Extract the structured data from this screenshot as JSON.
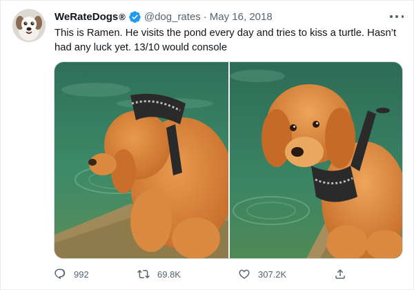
{
  "tweet": {
    "author": {
      "display_name": "WeRateDogs",
      "registered_mark": "®",
      "handle": "@dog_rates",
      "verified": true
    },
    "separator": "·",
    "date": "May 16, 2018",
    "text": "This is Ramen. He visits the pond every day and tries to kiss a turtle. Hasn’t had any luck yet. 13/10 would console",
    "media": [
      {
        "subject": "puppy leaning toward the pond water"
      },
      {
        "subject": "puppy sitting at the pond edge looking up"
      }
    ],
    "stats": {
      "replies": "992",
      "retweets": "69.8K",
      "likes": "307.2K"
    }
  },
  "colors": {
    "accent": "#1d9bf0",
    "text": "#0f1419",
    "secondary": "#536471",
    "water": "#2f7a5e",
    "puppy": "#d9813a"
  },
  "icons": [
    "avatar",
    "verified-badge-icon",
    "more-icon",
    "reply-icon",
    "retweet-icon",
    "like-icon",
    "share-icon"
  ]
}
